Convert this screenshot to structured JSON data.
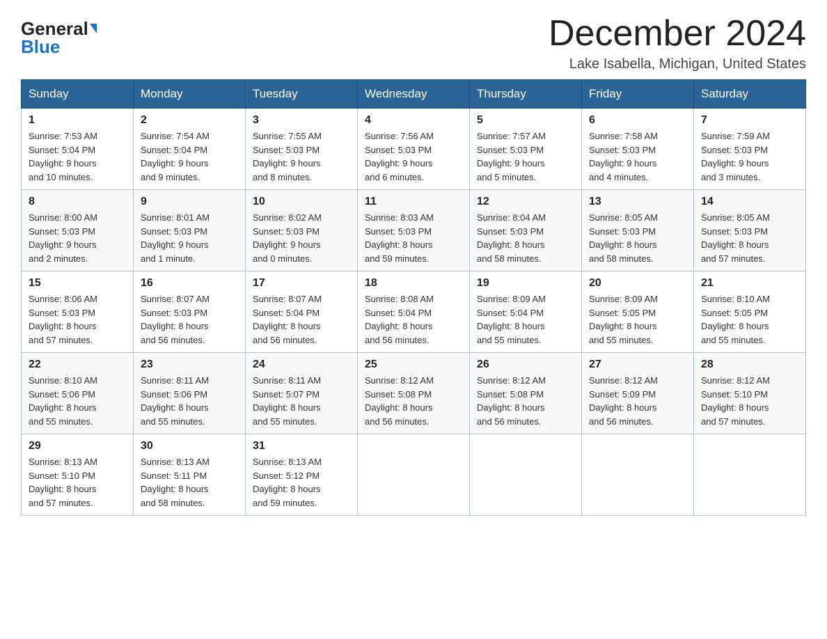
{
  "header": {
    "logo_general": "General",
    "logo_blue": "Blue",
    "title": "December 2024",
    "location": "Lake Isabella, Michigan, United States"
  },
  "weekdays": [
    "Sunday",
    "Monday",
    "Tuesday",
    "Wednesday",
    "Thursday",
    "Friday",
    "Saturday"
  ],
  "weeks": [
    [
      {
        "day": "1",
        "info": "Sunrise: 7:53 AM\nSunset: 5:04 PM\nDaylight: 9 hours\nand 10 minutes."
      },
      {
        "day": "2",
        "info": "Sunrise: 7:54 AM\nSunset: 5:04 PM\nDaylight: 9 hours\nand 9 minutes."
      },
      {
        "day": "3",
        "info": "Sunrise: 7:55 AM\nSunset: 5:03 PM\nDaylight: 9 hours\nand 8 minutes."
      },
      {
        "day": "4",
        "info": "Sunrise: 7:56 AM\nSunset: 5:03 PM\nDaylight: 9 hours\nand 6 minutes."
      },
      {
        "day": "5",
        "info": "Sunrise: 7:57 AM\nSunset: 5:03 PM\nDaylight: 9 hours\nand 5 minutes."
      },
      {
        "day": "6",
        "info": "Sunrise: 7:58 AM\nSunset: 5:03 PM\nDaylight: 9 hours\nand 4 minutes."
      },
      {
        "day": "7",
        "info": "Sunrise: 7:59 AM\nSunset: 5:03 PM\nDaylight: 9 hours\nand 3 minutes."
      }
    ],
    [
      {
        "day": "8",
        "info": "Sunrise: 8:00 AM\nSunset: 5:03 PM\nDaylight: 9 hours\nand 2 minutes."
      },
      {
        "day": "9",
        "info": "Sunrise: 8:01 AM\nSunset: 5:03 PM\nDaylight: 9 hours\nand 1 minute."
      },
      {
        "day": "10",
        "info": "Sunrise: 8:02 AM\nSunset: 5:03 PM\nDaylight: 9 hours\nand 0 minutes."
      },
      {
        "day": "11",
        "info": "Sunrise: 8:03 AM\nSunset: 5:03 PM\nDaylight: 8 hours\nand 59 minutes."
      },
      {
        "day": "12",
        "info": "Sunrise: 8:04 AM\nSunset: 5:03 PM\nDaylight: 8 hours\nand 58 minutes."
      },
      {
        "day": "13",
        "info": "Sunrise: 8:05 AM\nSunset: 5:03 PM\nDaylight: 8 hours\nand 58 minutes."
      },
      {
        "day": "14",
        "info": "Sunrise: 8:05 AM\nSunset: 5:03 PM\nDaylight: 8 hours\nand 57 minutes."
      }
    ],
    [
      {
        "day": "15",
        "info": "Sunrise: 8:06 AM\nSunset: 5:03 PM\nDaylight: 8 hours\nand 57 minutes."
      },
      {
        "day": "16",
        "info": "Sunrise: 8:07 AM\nSunset: 5:03 PM\nDaylight: 8 hours\nand 56 minutes."
      },
      {
        "day": "17",
        "info": "Sunrise: 8:07 AM\nSunset: 5:04 PM\nDaylight: 8 hours\nand 56 minutes."
      },
      {
        "day": "18",
        "info": "Sunrise: 8:08 AM\nSunset: 5:04 PM\nDaylight: 8 hours\nand 56 minutes."
      },
      {
        "day": "19",
        "info": "Sunrise: 8:09 AM\nSunset: 5:04 PM\nDaylight: 8 hours\nand 55 minutes."
      },
      {
        "day": "20",
        "info": "Sunrise: 8:09 AM\nSunset: 5:05 PM\nDaylight: 8 hours\nand 55 minutes."
      },
      {
        "day": "21",
        "info": "Sunrise: 8:10 AM\nSunset: 5:05 PM\nDaylight: 8 hours\nand 55 minutes."
      }
    ],
    [
      {
        "day": "22",
        "info": "Sunrise: 8:10 AM\nSunset: 5:06 PM\nDaylight: 8 hours\nand 55 minutes."
      },
      {
        "day": "23",
        "info": "Sunrise: 8:11 AM\nSunset: 5:06 PM\nDaylight: 8 hours\nand 55 minutes."
      },
      {
        "day": "24",
        "info": "Sunrise: 8:11 AM\nSunset: 5:07 PM\nDaylight: 8 hours\nand 55 minutes."
      },
      {
        "day": "25",
        "info": "Sunrise: 8:12 AM\nSunset: 5:08 PM\nDaylight: 8 hours\nand 56 minutes."
      },
      {
        "day": "26",
        "info": "Sunrise: 8:12 AM\nSunset: 5:08 PM\nDaylight: 8 hours\nand 56 minutes."
      },
      {
        "day": "27",
        "info": "Sunrise: 8:12 AM\nSunset: 5:09 PM\nDaylight: 8 hours\nand 56 minutes."
      },
      {
        "day": "28",
        "info": "Sunrise: 8:12 AM\nSunset: 5:10 PM\nDaylight: 8 hours\nand 57 minutes."
      }
    ],
    [
      {
        "day": "29",
        "info": "Sunrise: 8:13 AM\nSunset: 5:10 PM\nDaylight: 8 hours\nand 57 minutes."
      },
      {
        "day": "30",
        "info": "Sunrise: 8:13 AM\nSunset: 5:11 PM\nDaylight: 8 hours\nand 58 minutes."
      },
      {
        "day": "31",
        "info": "Sunrise: 8:13 AM\nSunset: 5:12 PM\nDaylight: 8 hours\nand 59 minutes."
      },
      {
        "day": "",
        "info": ""
      },
      {
        "day": "",
        "info": ""
      },
      {
        "day": "",
        "info": ""
      },
      {
        "day": "",
        "info": ""
      }
    ]
  ]
}
